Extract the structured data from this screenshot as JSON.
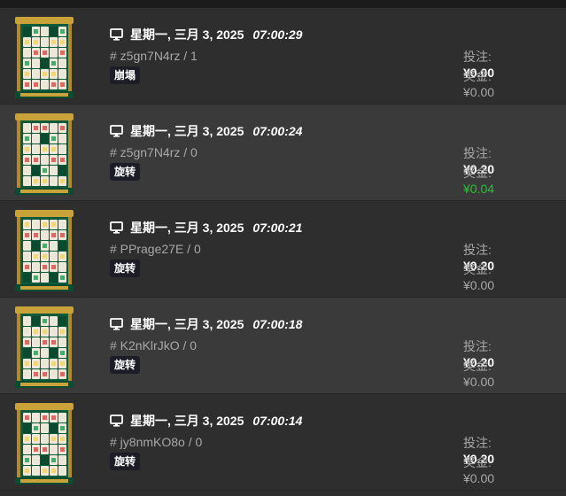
{
  "labels": {
    "bet": "投注:",
    "win": "奖金:"
  },
  "colors": {
    "win_positive": "#2fbf3a",
    "badge_bg": "#1c1d27"
  },
  "rounds": [
    {
      "date": "星期一, 三月 3, 2025",
      "time": "07:00:29",
      "round_id": "# z5gn7N4rz / 1",
      "tag": "崩塌",
      "bet": "¥0.00",
      "win": "¥0.00",
      "win_positive": false
    },
    {
      "date": "星期一, 三月 3, 2025",
      "time": "07:00:24",
      "round_id": "# z5gn7N4rz / 0",
      "tag": "旋转",
      "bet": "¥0.20",
      "win": "¥0.04",
      "win_positive": true
    },
    {
      "date": "星期一, 三月 3, 2025",
      "time": "07:00:21",
      "round_id": "# PPrage27E / 0",
      "tag": "旋转",
      "bet": "¥0.20",
      "win": "¥0.00",
      "win_positive": false
    },
    {
      "date": "星期一, 三月 3, 2025",
      "time": "07:00:18",
      "round_id": "# K2nKlrJkO / 0",
      "tag": "旋转",
      "bet": "¥0.20",
      "win": "¥0.00",
      "win_positive": false
    },
    {
      "date": "星期一, 三月 3, 2025",
      "time": "07:00:14",
      "round_id": "# jy8nmKO8o / 0",
      "tag": "旋转",
      "bet": "¥0.20",
      "win": "¥0.00",
      "win_positive": false
    }
  ]
}
